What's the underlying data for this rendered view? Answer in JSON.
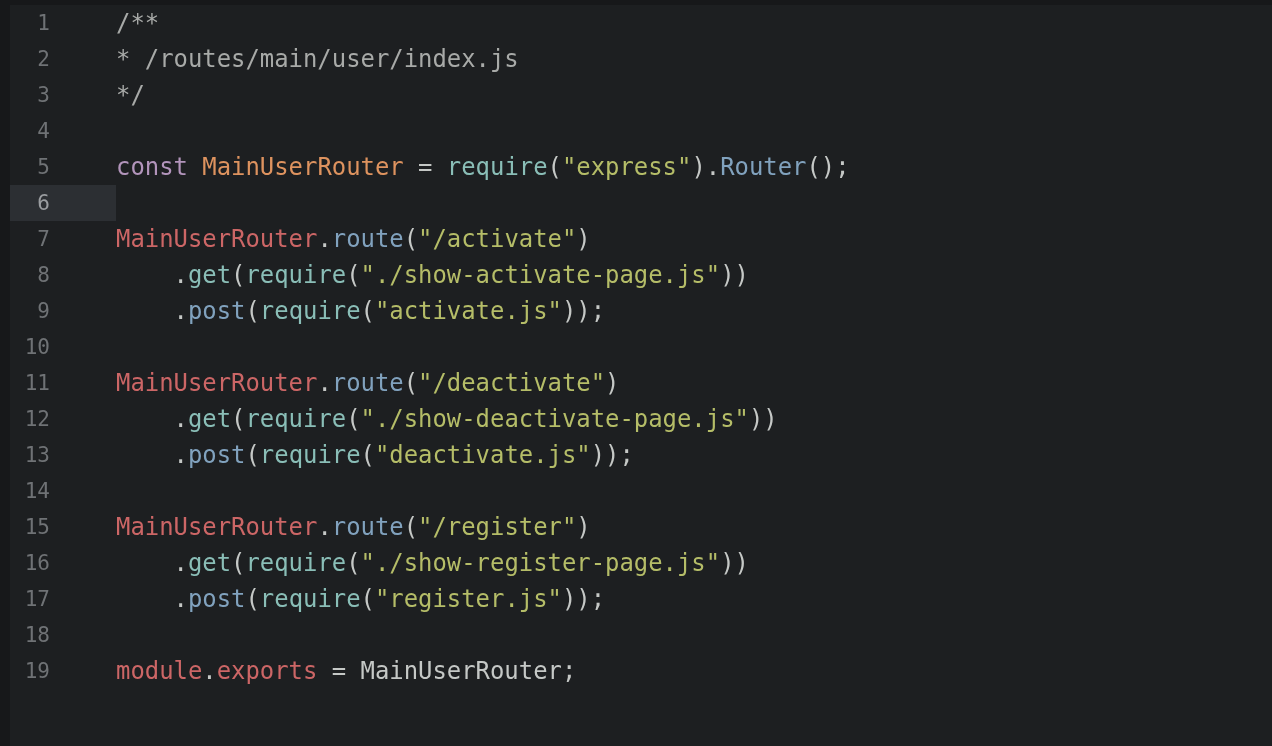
{
  "editor": {
    "lines": [
      {
        "number": "1",
        "selected": false,
        "tokens": [
          {
            "text": "/**",
            "kind": "comment"
          }
        ]
      },
      {
        "number": "2",
        "selected": false,
        "tokens": [
          {
            "text": "* /routes/main/user/index.js",
            "kind": "comment"
          }
        ]
      },
      {
        "number": "3",
        "selected": false,
        "tokens": [
          {
            "text": "*/",
            "kind": "comment"
          }
        ]
      },
      {
        "number": "4",
        "selected": false
      },
      {
        "number": "5",
        "selected": false,
        "tokens": [
          {
            "text": "const ",
            "kind": "keyword"
          },
          {
            "text": "MainUserRouter",
            "kind": "variable"
          },
          {
            "text": " = ",
            "kind": "plain"
          },
          {
            "text": "require",
            "kind": "function"
          },
          {
            "text": "(",
            "kind": "plain"
          },
          {
            "text": "\"express\"",
            "kind": "string"
          },
          {
            "text": ").",
            "kind": "plain"
          },
          {
            "text": "Router",
            "kind": "method"
          },
          {
            "text": "();",
            "kind": "plain"
          }
        ]
      },
      {
        "number": "6",
        "selected": true
      },
      {
        "number": "7",
        "selected": false,
        "tokens": [
          {
            "text": "MainUserRouter",
            "kind": "object"
          },
          {
            "text": ".",
            "kind": "plain"
          },
          {
            "text": "route",
            "kind": "method"
          },
          {
            "text": "(",
            "kind": "plain"
          },
          {
            "text": "\"/activate\"",
            "kind": "string"
          },
          {
            "text": ")",
            "kind": "plain"
          }
        ]
      },
      {
        "number": "8",
        "selected": false,
        "tokens": [
          {
            "text": "    .",
            "kind": "plain"
          },
          {
            "text": "get",
            "kind": "function"
          },
          {
            "text": "(",
            "kind": "plain"
          },
          {
            "text": "require",
            "kind": "function"
          },
          {
            "text": "(",
            "kind": "plain"
          },
          {
            "text": "\"./show-activate-page.js\"",
            "kind": "string"
          },
          {
            "text": "))",
            "kind": "plain"
          }
        ]
      },
      {
        "number": "9",
        "selected": false,
        "tokens": [
          {
            "text": "    .",
            "kind": "plain"
          },
          {
            "text": "post",
            "kind": "method"
          },
          {
            "text": "(",
            "kind": "plain"
          },
          {
            "text": "require",
            "kind": "function"
          },
          {
            "text": "(",
            "kind": "plain"
          },
          {
            "text": "\"activate.js\"",
            "kind": "string"
          },
          {
            "text": "));",
            "kind": "plain"
          }
        ]
      },
      {
        "number": "10",
        "selected": false
      },
      {
        "number": "11",
        "selected": false,
        "tokens": [
          {
            "text": "MainUserRouter",
            "kind": "object"
          },
          {
            "text": ".",
            "kind": "plain"
          },
          {
            "text": "route",
            "kind": "method"
          },
          {
            "text": "(",
            "kind": "plain"
          },
          {
            "text": "\"/deactivate\"",
            "kind": "string"
          },
          {
            "text": ")",
            "kind": "plain"
          }
        ]
      },
      {
        "number": "12",
        "selected": false,
        "tokens": [
          {
            "text": "    .",
            "kind": "plain"
          },
          {
            "text": "get",
            "kind": "function"
          },
          {
            "text": "(",
            "kind": "plain"
          },
          {
            "text": "require",
            "kind": "function"
          },
          {
            "text": "(",
            "kind": "plain"
          },
          {
            "text": "\"./show-deactivate-page.js\"",
            "kind": "string"
          },
          {
            "text": "))",
            "kind": "plain"
          }
        ]
      },
      {
        "number": "13",
        "selected": false,
        "tokens": [
          {
            "text": "    .",
            "kind": "plain"
          },
          {
            "text": "post",
            "kind": "method"
          },
          {
            "text": "(",
            "kind": "plain"
          },
          {
            "text": "require",
            "kind": "function"
          },
          {
            "text": "(",
            "kind": "plain"
          },
          {
            "text": "\"deactivate.js\"",
            "kind": "string"
          },
          {
            "text": "));",
            "kind": "plain"
          }
        ]
      },
      {
        "number": "14",
        "selected": false
      },
      {
        "number": "15",
        "selected": false,
        "tokens": [
          {
            "text": "MainUserRouter",
            "kind": "object"
          },
          {
            "text": ".",
            "kind": "plain"
          },
          {
            "text": "route",
            "kind": "method"
          },
          {
            "text": "(",
            "kind": "plain"
          },
          {
            "text": "\"/register\"",
            "kind": "string"
          },
          {
            "text": ")",
            "kind": "plain"
          }
        ]
      },
      {
        "number": "16",
        "selected": false,
        "tokens": [
          {
            "text": "    .",
            "kind": "plain"
          },
          {
            "text": "get",
            "kind": "function"
          },
          {
            "text": "(",
            "kind": "plain"
          },
          {
            "text": "require",
            "kind": "function"
          },
          {
            "text": "(",
            "kind": "plain"
          },
          {
            "text": "\"./show-register-page.js\"",
            "kind": "string"
          },
          {
            "text": "))",
            "kind": "plain"
          }
        ]
      },
      {
        "number": "17",
        "selected": false,
        "tokens": [
          {
            "text": "    .",
            "kind": "plain"
          },
          {
            "text": "post",
            "kind": "method"
          },
          {
            "text": "(",
            "kind": "plain"
          },
          {
            "text": "require",
            "kind": "function"
          },
          {
            "text": "(",
            "kind": "plain"
          },
          {
            "text": "\"register.js\"",
            "kind": "string"
          },
          {
            "text": "));",
            "kind": "plain"
          }
        ]
      },
      {
        "number": "18",
        "selected": false
      },
      {
        "number": "19",
        "selected": false,
        "tokens": [
          {
            "text": "module",
            "kind": "object"
          },
          {
            "text": ".",
            "kind": "plain"
          },
          {
            "text": "exports",
            "kind": "object"
          },
          {
            "text": " = MainUserRouter;",
            "kind": "plain"
          }
        ]
      }
    ]
  }
}
